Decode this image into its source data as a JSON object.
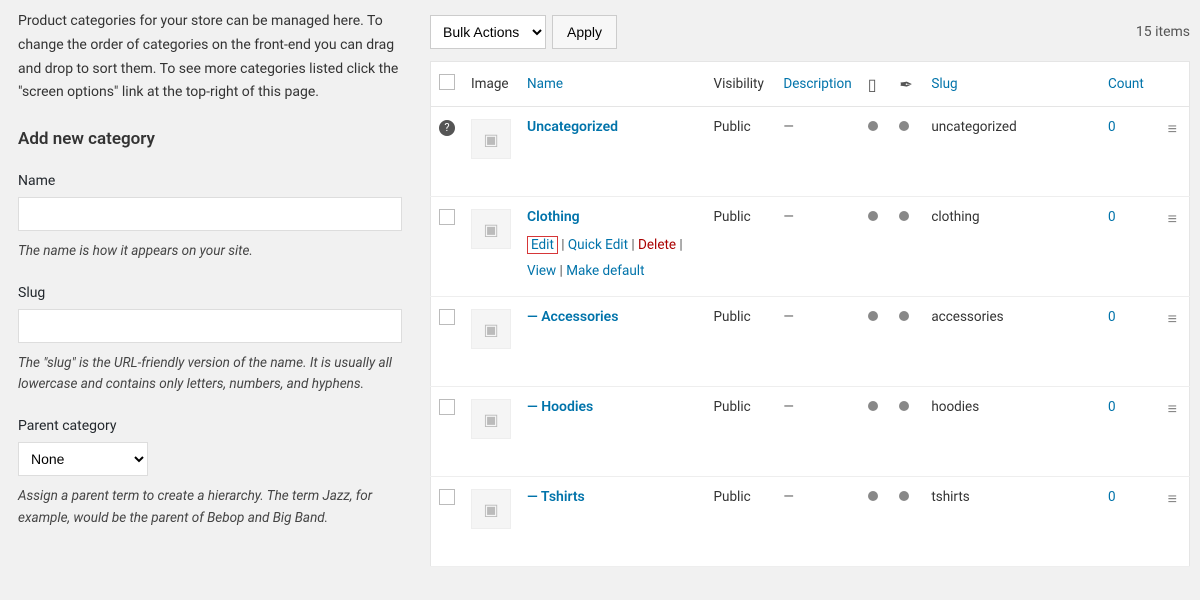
{
  "intro": "Product categories for your store can be managed here. To change the order of categories on the front-end you can drag and drop to sort them. To see more categories listed click the \"screen options\" link at the top-right of this page.",
  "add_heading": "Add new category",
  "form": {
    "name_label": "Name",
    "name_hint": "The name is how it appears on your site.",
    "slug_label": "Slug",
    "slug_hint": "The \"slug\" is the URL-friendly version of the name. It is usually all lowercase and contains only letters, numbers, and hyphens.",
    "parent_label": "Parent category",
    "parent_value": "None",
    "parent_hint": "Assign a parent term to create a hierarchy. The term Jazz, for example, would be the parent of Bebop and Big Band."
  },
  "toolbar": {
    "bulk_label": "Bulk Actions",
    "apply_label": "Apply",
    "items_count": "15 items"
  },
  "columns": {
    "image": "Image",
    "name": "Name",
    "visibility": "Visibility",
    "description": "Description",
    "slug": "Slug",
    "count": "Count"
  },
  "row_actions": {
    "edit": "Edit",
    "quick_edit": "Quick Edit",
    "delete": "Delete",
    "view": "View",
    "make_default": "Make default"
  },
  "rows": [
    {
      "name": "Uncategorized",
      "prefix": "",
      "visibility": "Public",
      "slug": "uncategorized",
      "count": "0",
      "help": true
    },
    {
      "name": "Clothing",
      "prefix": "",
      "visibility": "Public",
      "slug": "clothing",
      "count": "0",
      "actions": true
    },
    {
      "name": "Accessories",
      "prefix": "— ",
      "visibility": "Public",
      "slug": "accessories",
      "count": "0"
    },
    {
      "name": "Hoodies",
      "prefix": "— ",
      "visibility": "Public",
      "slug": "hoodies",
      "count": "0"
    },
    {
      "name": "Tshirts",
      "prefix": "— ",
      "visibility": "Public",
      "slug": "tshirts",
      "count": "0"
    }
  ]
}
